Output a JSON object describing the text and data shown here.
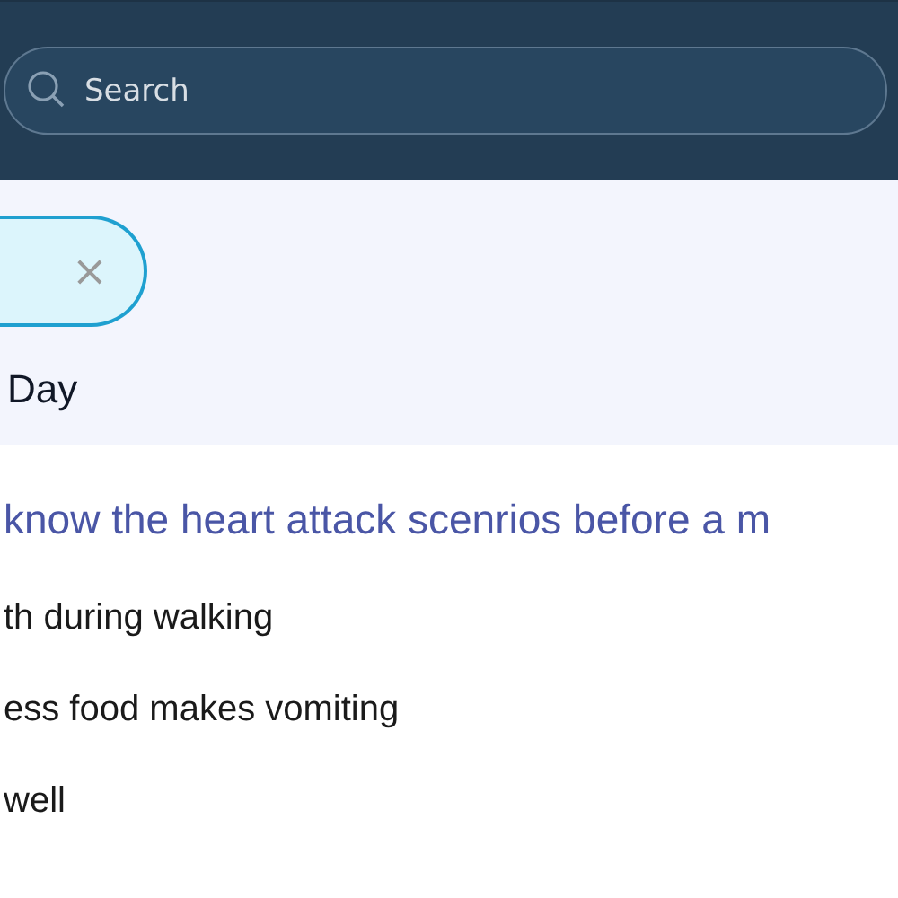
{
  "search": {
    "placeholder": "Search"
  },
  "filter_chip": {
    "remove": "×"
  },
  "section_title": "Day",
  "heading": "know the heart attack scenrios before a m",
  "items": [
    "th during walking",
    "ess food makes vomiting",
    "well"
  ]
}
